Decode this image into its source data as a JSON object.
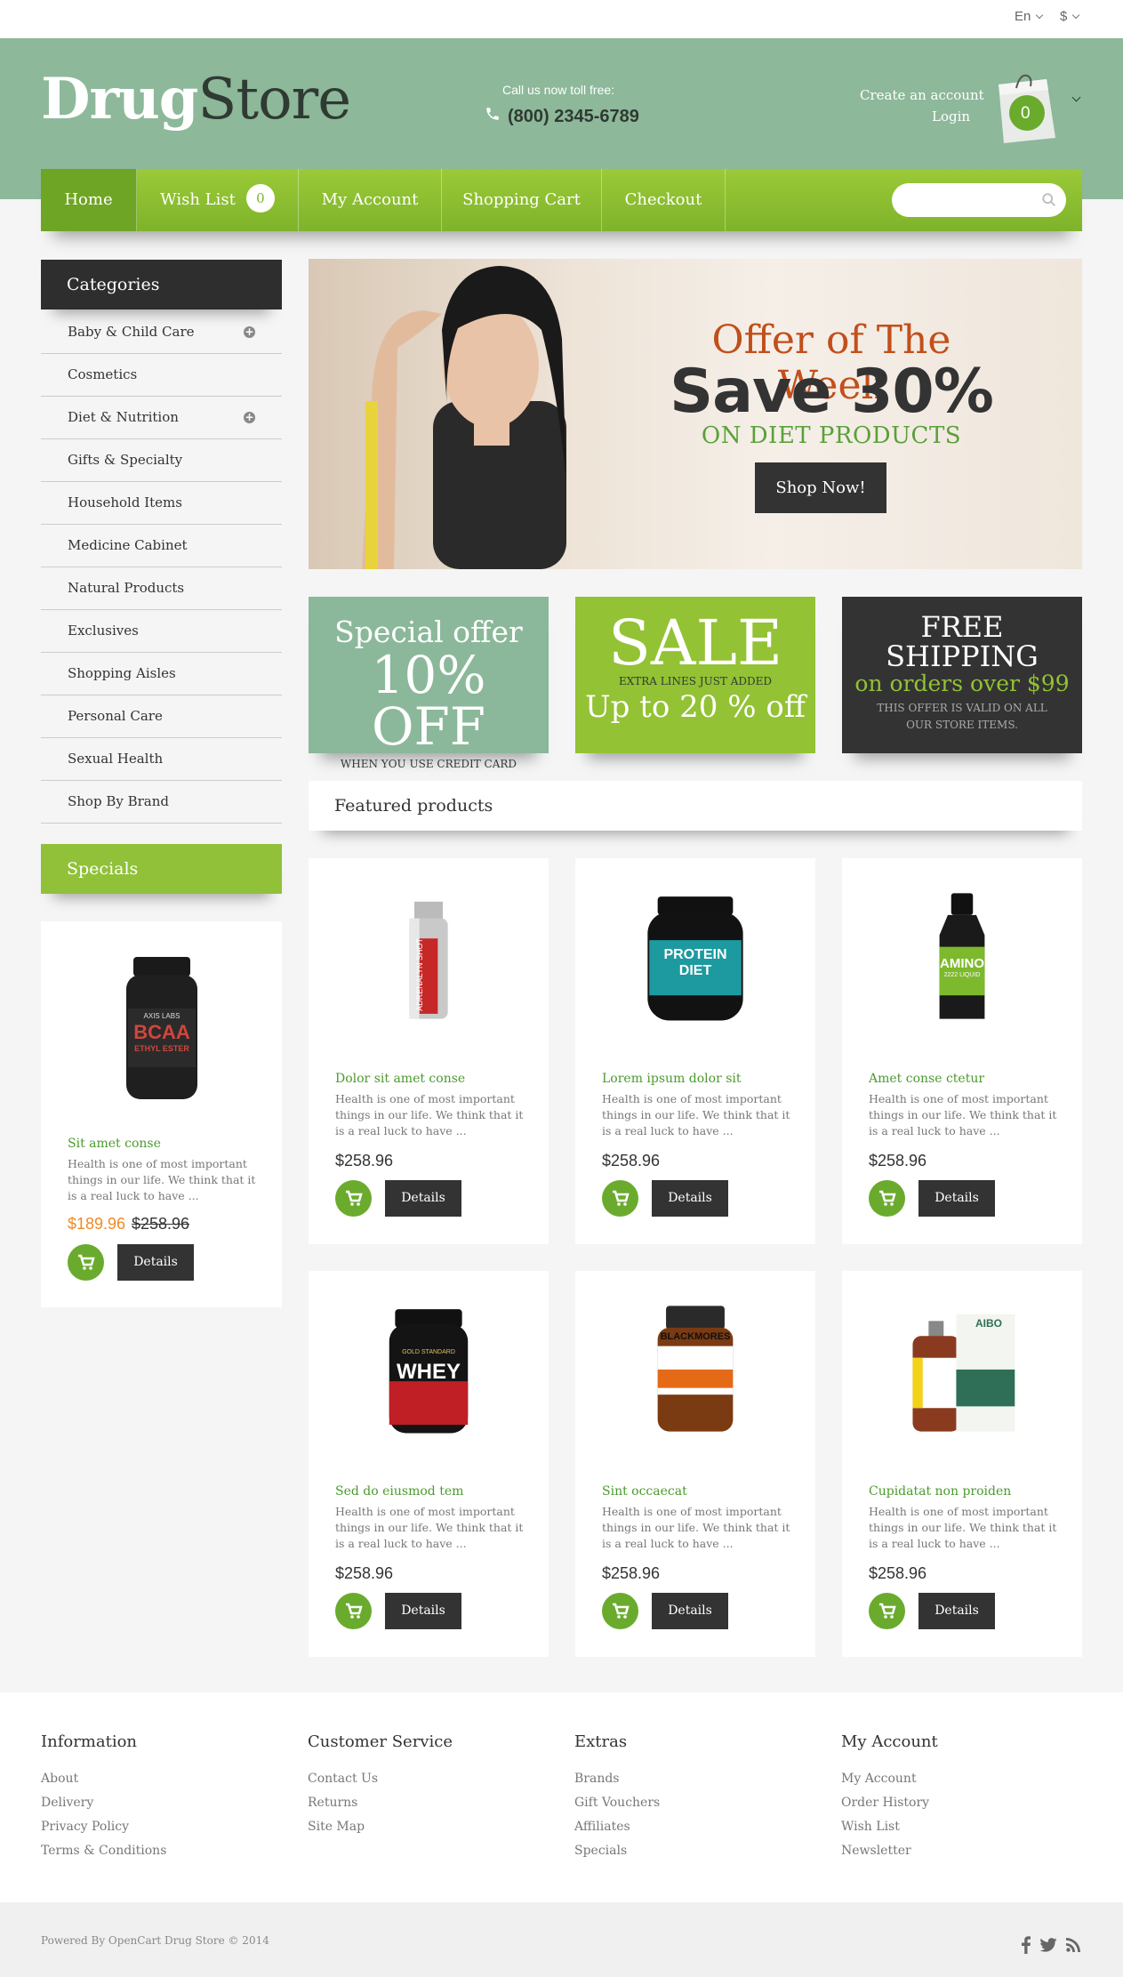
{
  "topbar": {
    "language": "En",
    "currency": "$"
  },
  "header": {
    "logo_bold": "Drug",
    "logo_light": "Store",
    "call_label": "Call us now toll free:",
    "phone": "(800) 2345-6789",
    "create_account": "Create an account",
    "login": "Login",
    "cart_count": "0"
  },
  "nav": {
    "home": "Home",
    "wishlist": "Wish List",
    "wishlist_count": "0",
    "account": "My Account",
    "cart": "Shopping Cart",
    "checkout": "Checkout",
    "search_placeholder": ""
  },
  "categories": {
    "title": "Categories",
    "items": [
      {
        "label": "Baby & Child Care",
        "expand": true
      },
      {
        "label": "Cosmetics"
      },
      {
        "label": "Diet & Nutrition",
        "expand": true
      },
      {
        "label": "Gifts & Specialty"
      },
      {
        "label": "Household Items"
      },
      {
        "label": "Medicine Cabinet"
      },
      {
        "label": "Natural Products"
      },
      {
        "label": "Exclusives"
      },
      {
        "label": "Shopping Aisles"
      },
      {
        "label": "Personal Care"
      },
      {
        "label": "Sexual Health"
      },
      {
        "label": "Shop By Brand"
      }
    ]
  },
  "specials": {
    "title": "Specials",
    "product": {
      "name": "Sit amet conse",
      "desc": "Health is one of most important things in our life. We think that it is a real luck to have ...",
      "price_new": "$189.96",
      "price_old": "$258.96",
      "details": "Details",
      "image_label_1": "AXIS LABS",
      "image_label_2": "BCAA",
      "image_label_3": "ETHYL ESTER"
    }
  },
  "banner": {
    "line1": "Offer of The Week",
    "line2": "Save 30%",
    "line3": "ON DIET PRODUCTS",
    "button": "Shop Now!"
  },
  "promos": {
    "p1": {
      "l1": "Special offer",
      "l2": "10% OFF",
      "l3": "WHEN YOU USE CREDIT CARD"
    },
    "p2": {
      "l1": "SALE",
      "l2": "EXTRA LINES JUST ADDED",
      "l3": "Up to 20 % off"
    },
    "p3": {
      "l1": "FREE",
      "l2": "SHIPPING",
      "l3": "on orders over $99",
      "l4": "THIS OFFER IS VALID ON ALL OUR STORE ITEMS."
    }
  },
  "featured": {
    "title": "Featured products",
    "products": [
      {
        "name": "Dolor sit amet conse",
        "desc": "Health is one of most important things in our life. We think that it is a real luck to have ...",
        "price": "$258.96",
        "details": "Details",
        "img1": "ADRENALYN SHOT",
        "img2": ""
      },
      {
        "name": "Lorem ipsum dolor sit",
        "desc": "Health is one of most important things in our life. We think that it is a real luck to have ...",
        "price": "$258.96",
        "details": "Details",
        "img1": "PROTEIN",
        "img2": "DIET"
      },
      {
        "name": "Amet conse ctetur",
        "desc": "Health is one of most important things in our life. We think that it is a real luck to have ...",
        "price": "$258.96",
        "details": "Details",
        "img1": "AMINO",
        "img2": "2222 LIQUID"
      },
      {
        "name": "Sed do eiusmod tem",
        "desc": "Health is one of most important things in our life. We think that it is a real luck to have ...",
        "price": "$258.96",
        "details": "Details",
        "img1": "WHEY",
        "img2": "GOLD STANDARD"
      },
      {
        "name": "Sint occaecat",
        "desc": "Health is one of most important things in our life. We think that it is a real luck to have ...",
        "price": "$258.96",
        "details": "Details",
        "img1": "BLACKMORES",
        "img2": "HORSERADISH, GARLIC"
      },
      {
        "name": "Cupidatat non proiden",
        "desc": "Health is one of most important things in our life. We think that it is a real luck to have ...",
        "price": "$258.96",
        "details": "Details",
        "img1": "AIBO",
        "img2": ""
      }
    ]
  },
  "footer": {
    "cols": [
      {
        "title": "Information",
        "links": [
          "About",
          "Delivery",
          "Privacy Policy",
          "Terms & Conditions"
        ]
      },
      {
        "title": "Customer Service",
        "links": [
          "Contact Us",
          "Returns",
          "Site Map"
        ]
      },
      {
        "title": "Extras",
        "links": [
          "Brands",
          "Gift Vouchers",
          "Affiliates",
          "Specials"
        ]
      },
      {
        "title": "My Account",
        "links": [
          "My Account",
          "Order History",
          "Wish List",
          "Newsletter"
        ]
      }
    ],
    "powered": "Powered By OpenCart Drug Store © 2014"
  },
  "colors": {
    "brand_green": "#90c139",
    "header_green": "#8db89a",
    "dark": "#2e2e2e",
    "accent_orange": "#f08a24",
    "link_green": "#4c9a2e"
  }
}
